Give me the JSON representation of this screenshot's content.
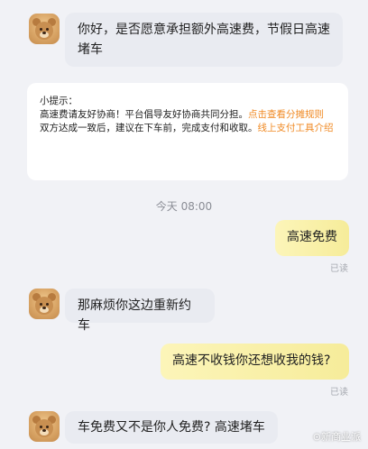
{
  "messages": {
    "m1": "你好，是否愿意承担额外高速费，节假日高速堵车",
    "m2": "高速免费",
    "m2_status": "已读",
    "m3": "那麻烦你这边重新约车",
    "m4": "高速不收钱你还想收我的钱?",
    "m4_status": "已读",
    "m5": "车免费又不是你人免费? 高速堵车"
  },
  "tips": {
    "title": "小提示：",
    "line1": "高速费请友好协商！平台倡导友好协商共同分担。",
    "link1": "点击查看分摊规则",
    "line2": "双方达成一致后，建议在下车前，完成支付和收取。",
    "link2": "线上支付工具介绍"
  },
  "timestamp": "今天 08:00",
  "watermark": "⊙新商业派",
  "colors": {
    "accent_orange": "#f08a24",
    "bubble_self": "#f6ec9a",
    "bubble_other": "#e9ebf1"
  }
}
